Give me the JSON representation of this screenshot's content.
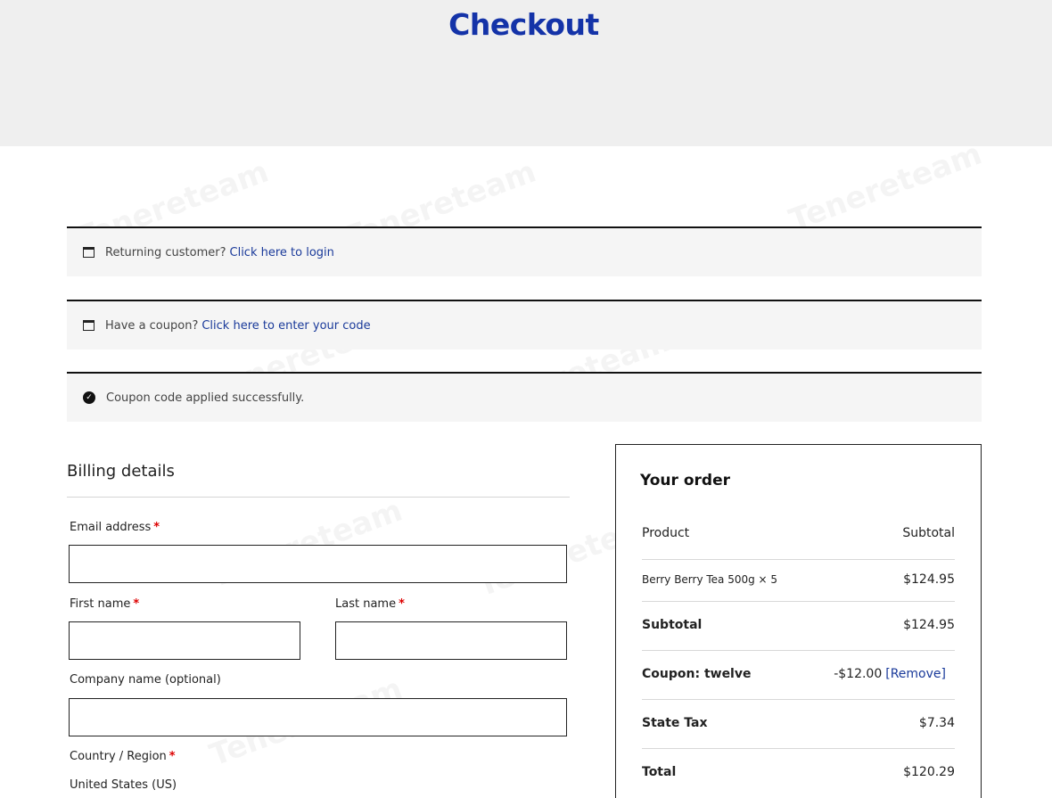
{
  "page": {
    "title": "Checkout",
    "accent_color": "#1433a8",
    "link_color": "#1a3a9a"
  },
  "notices": [
    {
      "icon": "window-icon",
      "text": "Returning customer?",
      "link": "Click here to login"
    },
    {
      "icon": "window-icon",
      "text": "Have a coupon?",
      "link": "Click here to enter your code"
    },
    {
      "icon": "check-circle-icon",
      "text": "Coupon code applied successfully."
    }
  ],
  "billing": {
    "title": "Billing details",
    "required_mark": "*",
    "fields": {
      "email": {
        "label": "Email address",
        "value": ""
      },
      "first_name": {
        "label": "First name",
        "value": ""
      },
      "last_name": {
        "label": "Last name",
        "value": ""
      },
      "company": {
        "label": "Company name (optional)",
        "value": ""
      },
      "country": {
        "label": "Country / Region",
        "value": "United States (US)"
      }
    }
  },
  "order": {
    "title": "Your order",
    "headers": {
      "product": "Product",
      "subtotal": "Subtotal"
    },
    "item": {
      "name": "Berry Berry Tea 500g × 5",
      "amount": "$124.95"
    },
    "subtotal": {
      "label": "Subtotal",
      "amount": "$124.95"
    },
    "coupon": {
      "label": "Coupon: twelve",
      "amount": "-$12.00",
      "remove": "[Remove]"
    },
    "tax": {
      "label": "State Tax",
      "amount": "$7.34"
    },
    "total": {
      "label": "Total",
      "amount": "$120.29"
    }
  },
  "watermark": {
    "text": "Tenereteam"
  }
}
